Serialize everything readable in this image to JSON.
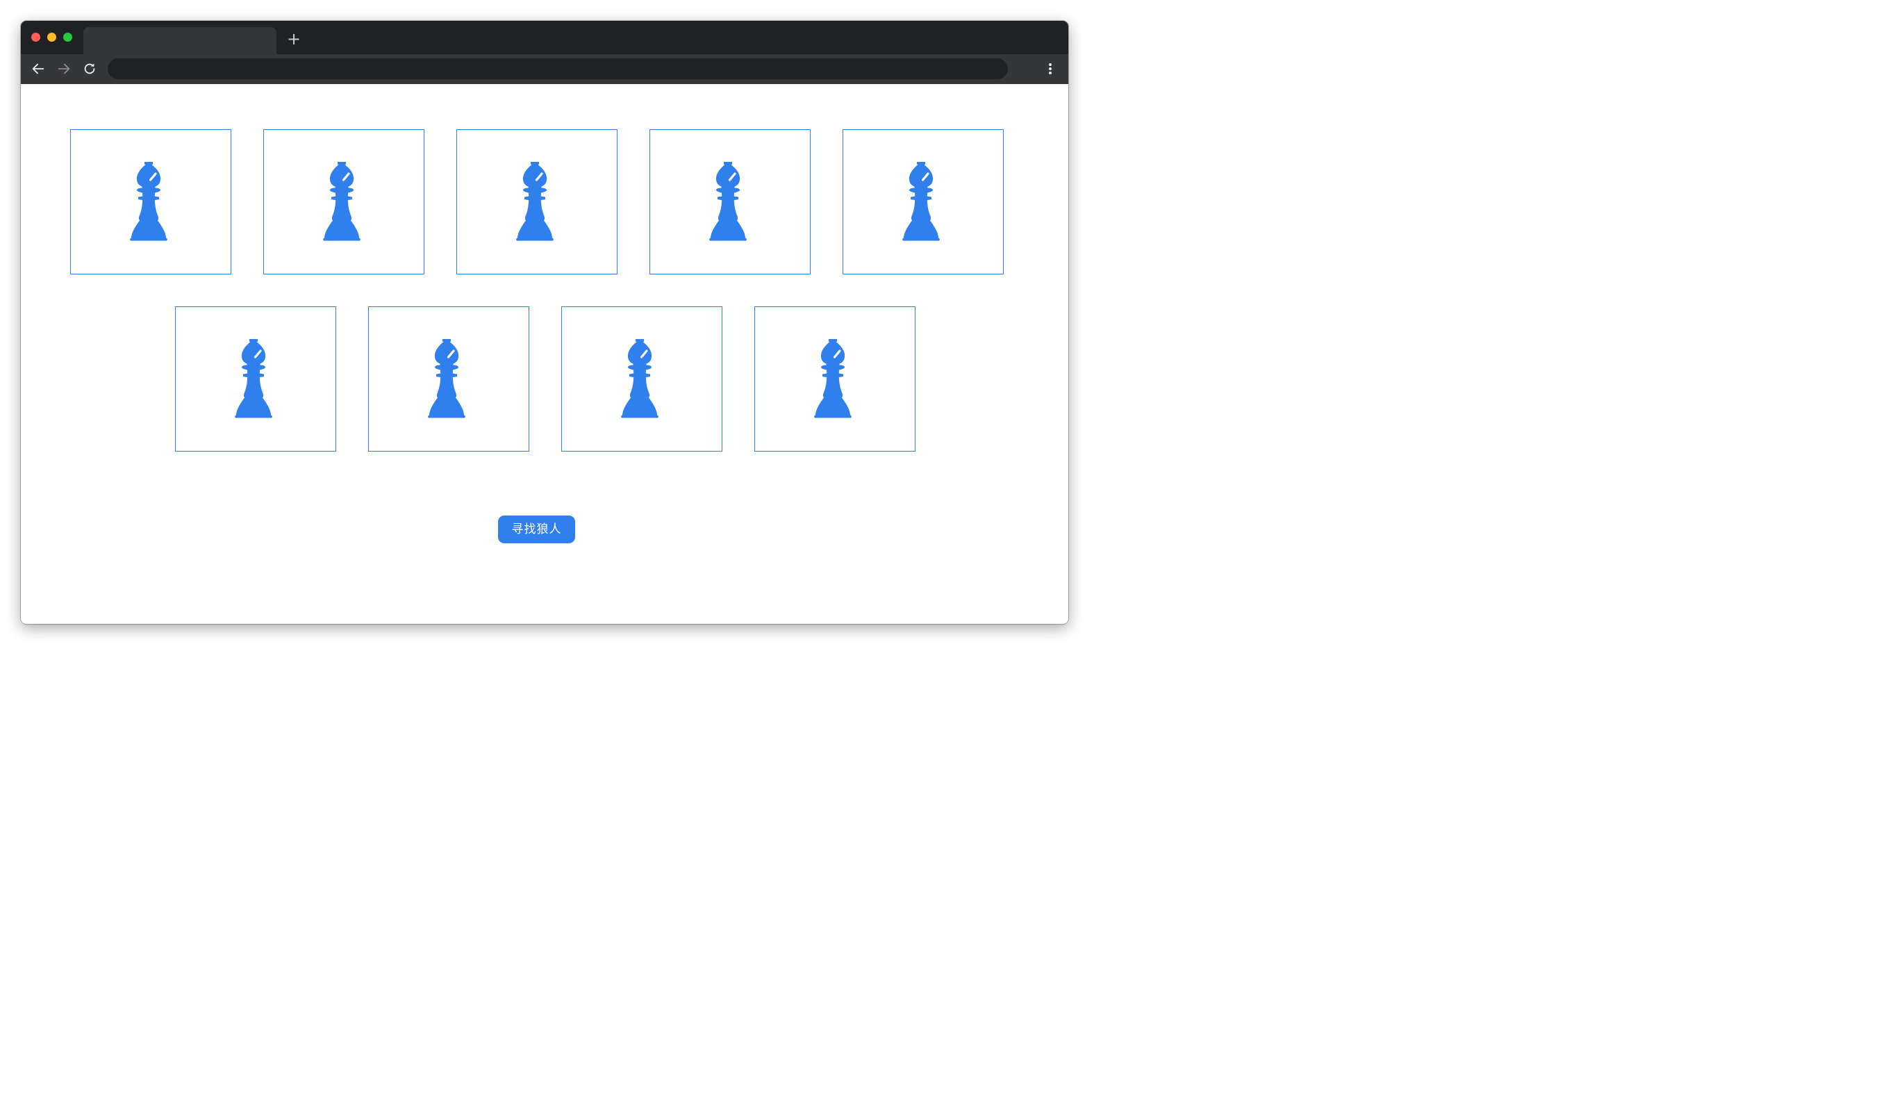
{
  "browser": {
    "tab_title": "",
    "new_tab_symbol": "+",
    "address": ""
  },
  "cards": [
    {
      "label": "bishop-piece"
    },
    {
      "label": "bishop-piece"
    },
    {
      "label": "bishop-piece"
    },
    {
      "label": "bishop-piece"
    },
    {
      "label": "bishop-piece"
    },
    {
      "label": "bishop-piece"
    },
    {
      "label": "bishop-piece"
    },
    {
      "label": "bishop-piece"
    },
    {
      "label": "bishop-piece"
    }
  ],
  "action": {
    "find_werewolf_label": "寻找狼人"
  },
  "colors": {
    "accent": "#2f80ed",
    "chrome_dark": "#202124",
    "chrome_toolbar": "#35363a"
  },
  "icons": {
    "back": "arrow-left-icon",
    "forward": "arrow-right-icon",
    "reload": "reload-icon",
    "menu": "kebab-menu-icon",
    "card_piece": "chess-bishop-icon"
  }
}
